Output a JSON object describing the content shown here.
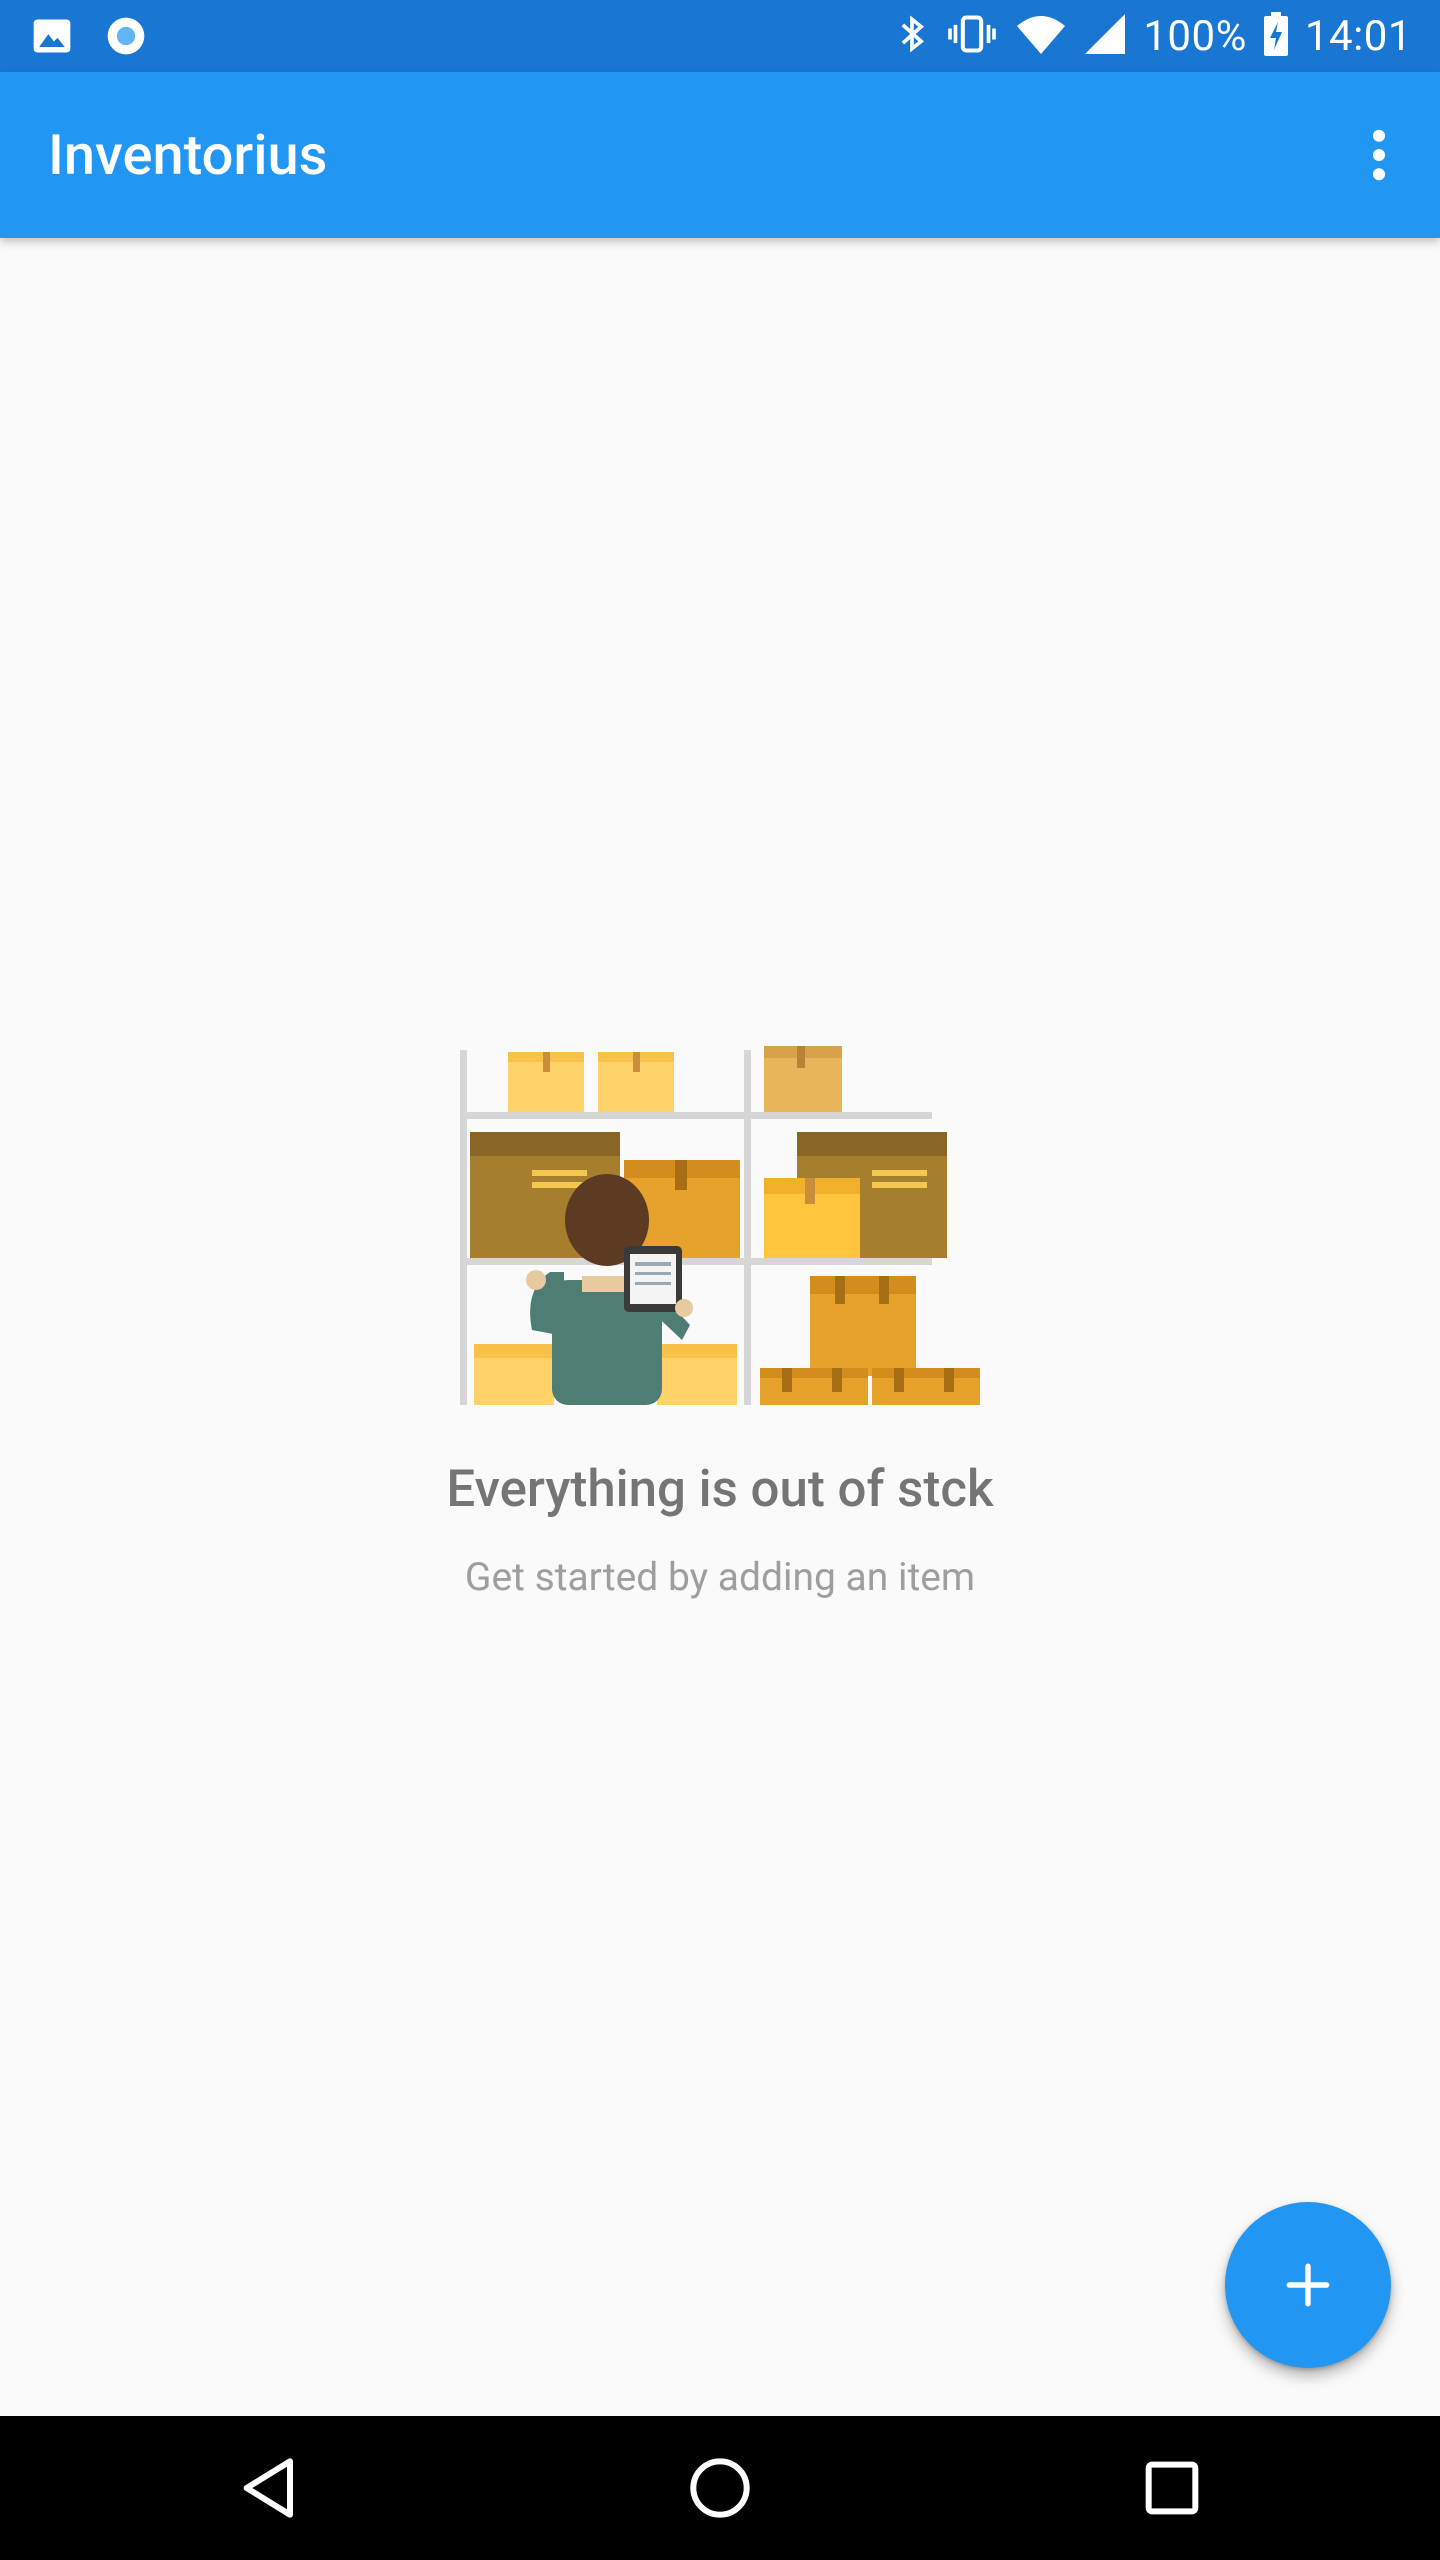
{
  "status_bar": {
    "notifications": [
      "image-icon",
      "record-icon"
    ],
    "system_icons": [
      "bluetooth-icon",
      "vibrate-icon",
      "wifi-icon",
      "signal-icon"
    ],
    "battery_text": "100%",
    "time": "14:01"
  },
  "app_bar": {
    "title": "Inventorius",
    "menu_icon": "more-vert-icon"
  },
  "empty_state": {
    "illustration": "warehouse-shelves-illustration",
    "title": "Everything is out of stck",
    "subtitle": "Get started by adding an item"
  },
  "fab": {
    "icon": "add-icon"
  },
  "nav_bar": {
    "buttons": [
      "back-icon",
      "home-icon",
      "recents-icon"
    ]
  },
  "colors": {
    "primary": "#2196F3",
    "primary_dark": "#1976D2",
    "background": "#FAFAFA",
    "title_text": "#757575",
    "subtitle_text": "#9E9E9E"
  }
}
